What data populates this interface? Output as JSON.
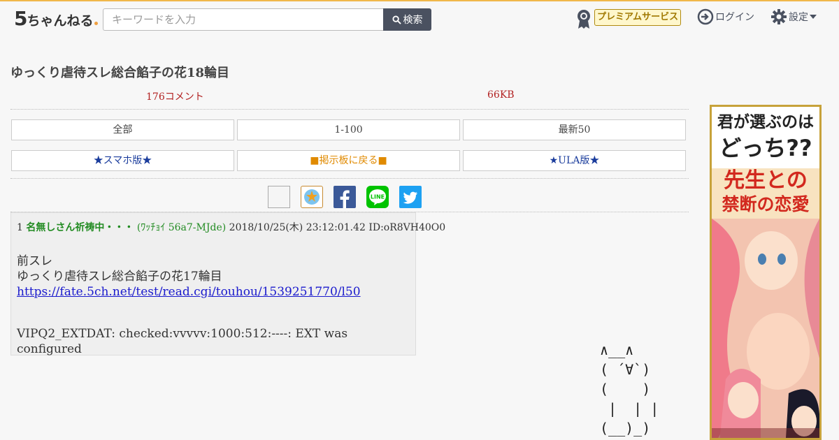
{
  "header": {
    "logo_five": "5",
    "logo_chan": "ちゃんねる",
    "search_placeholder": "キーワードを入力",
    "search_label": "検索",
    "premium_label": "プレミアムサービス",
    "login_label": "ログイン",
    "settings_label": "設定"
  },
  "thread": {
    "title": "ゆっくり虐待スレ総合餡子の花18輪目",
    "comments": "176コメント",
    "size": "66KB"
  },
  "nav_row1": [
    "全部",
    "1-100",
    "最新50"
  ],
  "nav_row2": [
    "★スマホ版★",
    "■掲示板に戻る■",
    "★ULA版★"
  ],
  "post": {
    "num": "1",
    "name": "名無しさん祈祷中・・・",
    "trip": "(ﾜｯﾁｮｲ 56a7-MJde)",
    "date": "2018/10/25(木) 23:12:01.42",
    "id": "ID:oR8VH40O0",
    "line1": "前スレ",
    "line2": "ゆっくり虐待スレ総合餡子の花17輪目",
    "link": "https://fate.5ch.net/test/read.cgi/touhou/1539251770/l50",
    "line4": "VIPQ2_EXTDAT: checked:vvvvv:1000:512:----: EXT was configured"
  },
  "ascii_art": "∧__∧\n( ´∀`)\n(    )\n |  | |\n(__)_)",
  "ad": {
    "line1": "君が選ぶのは",
    "line2": "どっち??",
    "line3": "先生との",
    "line4": "禁断の恋愛"
  },
  "colors": {
    "header_border": "#f0b74a",
    "search_button": "#4a5160",
    "comment_count": "#b22222",
    "poster_name": "#228b22",
    "link": "#1a1acd"
  }
}
